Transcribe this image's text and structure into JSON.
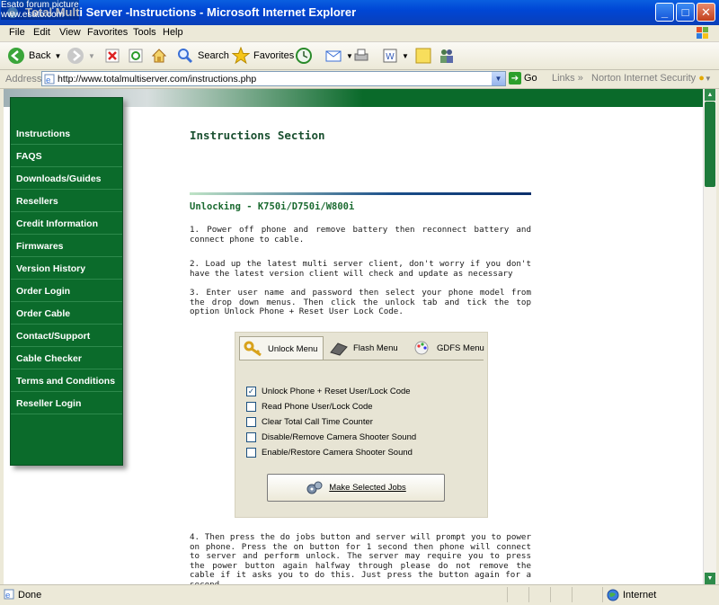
{
  "watermark": {
    "line1": "Esato forum picture",
    "line2": "www.esato.com"
  },
  "window": {
    "title": "Total Multi Server -Instructions - Microsoft Internet Explorer"
  },
  "menu": {
    "file": "File",
    "edit": "Edit",
    "view": "View",
    "favorites": "Favorites",
    "tools": "Tools",
    "help": "Help"
  },
  "toolbar": {
    "back": "Back",
    "search": "Search",
    "favorites": "Favorites"
  },
  "address": {
    "label": "Address",
    "url": "http://www.totalmultiserver.com/instructions.php",
    "go": "Go",
    "links": "Links",
    "norton": "Norton Internet Security"
  },
  "sidebar": {
    "items": [
      "Instructions",
      "FAQS",
      "Downloads/Guides",
      "Resellers",
      "Credit Information",
      "Firmwares",
      "Version History",
      "Order Login",
      "Order Cable",
      "Contact/Support",
      "Cable Checker",
      "Terms and Conditions",
      "Reseller Login"
    ]
  },
  "content": {
    "title": "Instructions Section",
    "section": "Unlocking - K750i/D750i/W800i",
    "p1": "1. Power off phone and remove battery then reconnect battery and connect phone to cable.",
    "p2": "2. Load up the latest multi server client, don't worry if you don't have the latest version client will check and update as necessary",
    "p3": "3. Enter user name and password then select your phone model from the drop down menus. Then click the unlock tab and tick the top option Unlock Phone + Reset User Lock Code.",
    "p4": "4. Then press the do jobs button and server will prompt you to power on phone. Press the on button for 1 second then phone will connect to server and perform unlock. The server may require you to press the power button again halfway through please do not remove the cable if it asks you to do this. Just press the button again for a second."
  },
  "panel": {
    "tabs": [
      "Unlock Menu",
      "Flash Menu",
      "GDFS Menu"
    ],
    "options": [
      {
        "label": "Unlock Phone + Reset User/Lock Code",
        "checked": true
      },
      {
        "label": "Read Phone User/Lock Code",
        "checked": false
      },
      {
        "label": "Clear Total Call Time Counter",
        "checked": false
      },
      {
        "label": "Disable/Remove Camera Shooter Sound",
        "checked": false
      },
      {
        "label": "Enable/Restore Camera Shooter Sound",
        "checked": false
      }
    ],
    "button": "Make Selected Jobs"
  },
  "status": {
    "text": "Done",
    "zone": "Internet"
  },
  "colors": {
    "nav_green": "#0b6b2b",
    "title_blue": "#0046d5",
    "heading": "#1a5030"
  }
}
